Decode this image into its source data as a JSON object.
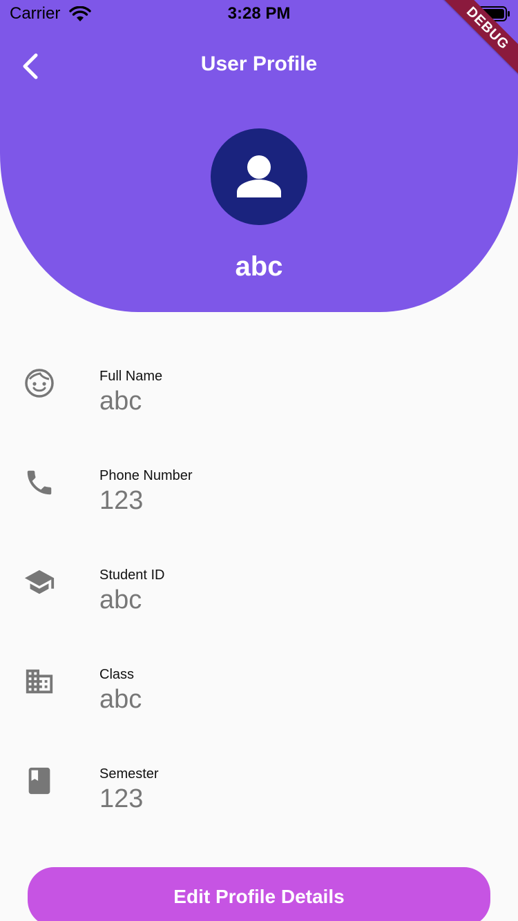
{
  "status_bar": {
    "carrier": "Carrier",
    "time": "3:28 PM"
  },
  "debug_banner": "DEBUG",
  "app_bar": {
    "title": "User Profile",
    "back_icon": "chevron-left-icon"
  },
  "profile": {
    "avatar_icon": "person-icon",
    "name": "abc"
  },
  "fields": [
    {
      "icon": "face-icon",
      "label": "Full Name",
      "value": "abc"
    },
    {
      "icon": "phone-icon",
      "label": "Phone Number",
      "value": "123"
    },
    {
      "icon": "school-icon",
      "label": "Student ID",
      "value": "abc"
    },
    {
      "icon": "building-icon",
      "label": "Class",
      "value": "abc"
    },
    {
      "icon": "book-icon",
      "label": "Semester",
      "value": "123"
    }
  ],
  "actions": {
    "edit_label": "Edit Profile Details"
  },
  "colors": {
    "header": "#7e57e8",
    "avatar_bg": "#1a237e",
    "button": "#c654e3",
    "icon_gray": "#777777",
    "debug_banner": "#8b1a3d"
  }
}
